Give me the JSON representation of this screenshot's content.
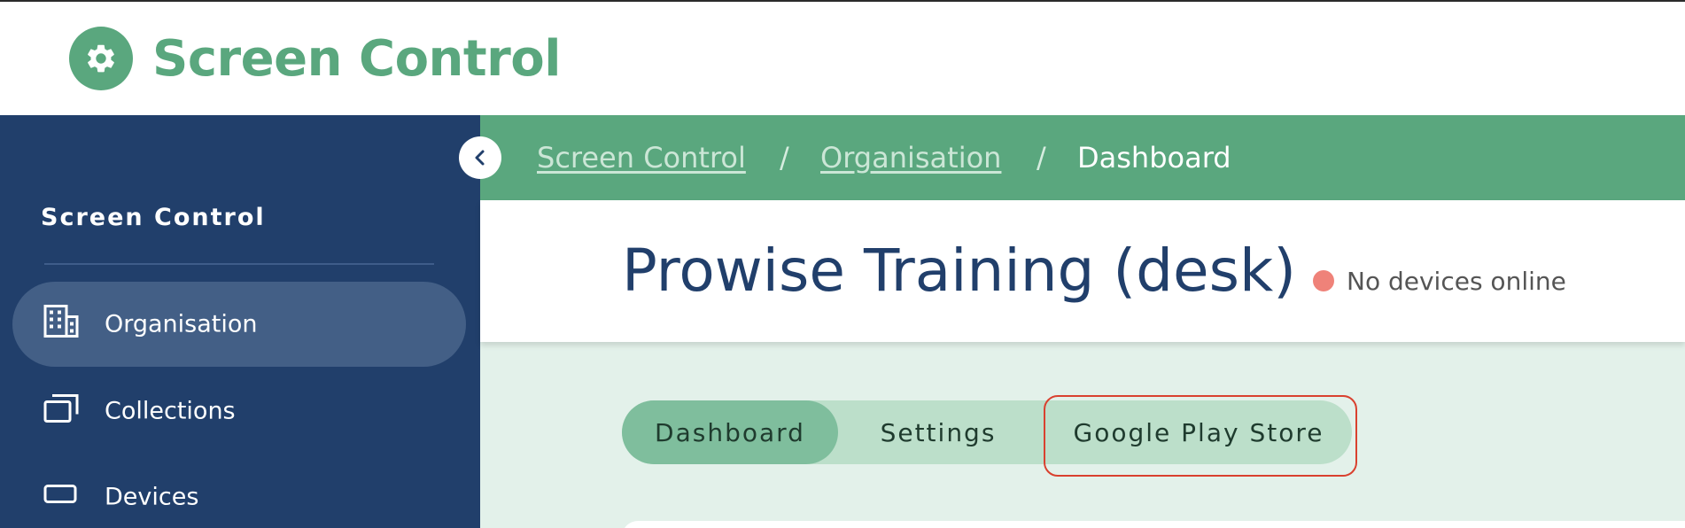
{
  "app": {
    "title": "Screen Control",
    "logo_icon": "gear-icon",
    "accent_color": "#5aa77e",
    "sidebar_color": "#213f6b"
  },
  "sidebar": {
    "title": "Screen Control",
    "collapse_icon": "chevron-left-icon",
    "items": [
      {
        "label": "Organisation",
        "icon": "building-icon",
        "active": true
      },
      {
        "label": "Collections",
        "icon": "collections-icon",
        "active": false
      },
      {
        "label": "Devices",
        "icon": "device-icon",
        "active": false
      }
    ]
  },
  "breadcrumb": {
    "items": [
      {
        "label": "Screen Control",
        "link": true
      },
      {
        "label": "Organisation",
        "link": true
      },
      {
        "label": "Dashboard",
        "link": false
      }
    ],
    "separator": "/"
  },
  "header": {
    "title": "Prowise Training (desk)",
    "status_text": "No devices online",
    "status_color": "#ef8279"
  },
  "tabs": {
    "items": [
      {
        "label": "Dashboard",
        "active": true
      },
      {
        "label": "Settings",
        "active": false
      },
      {
        "label": "Google Play Store",
        "active": false,
        "highlighted": true
      }
    ],
    "highlight_color": "#d9412f"
  }
}
